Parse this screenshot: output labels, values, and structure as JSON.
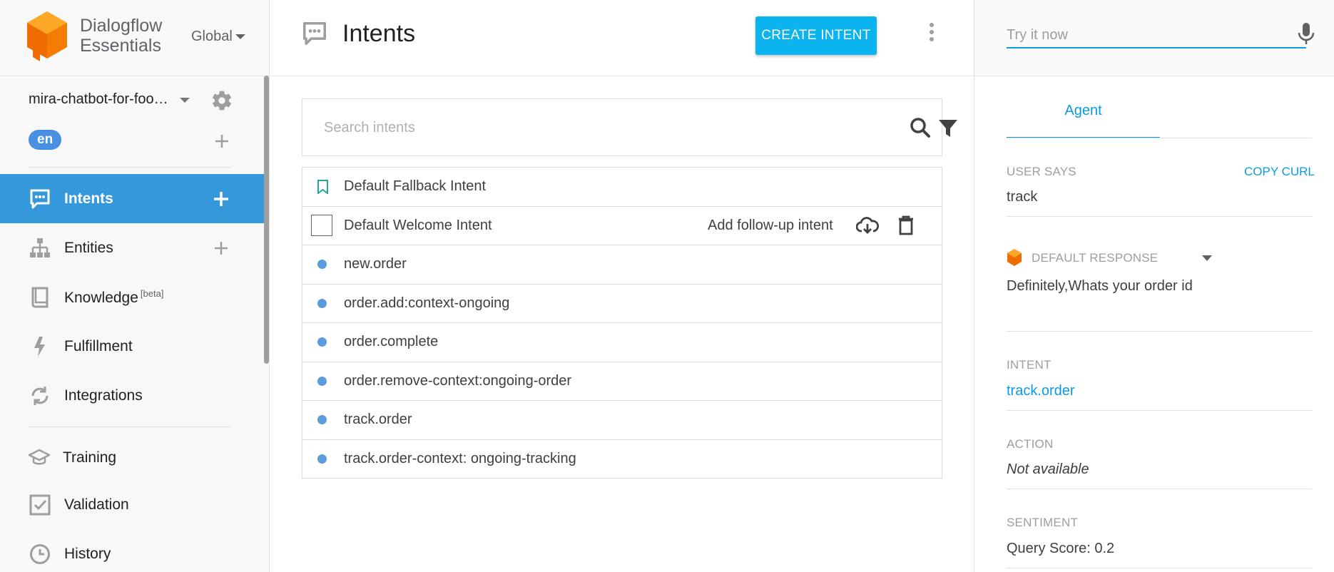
{
  "brand": {
    "line1": "Dialogflow",
    "line2": "Essentials",
    "region": "Global"
  },
  "agent": {
    "name": "mira-chatbot-for-food-delivery",
    "language": "en"
  },
  "nav": {
    "intents": "Intents",
    "entities": "Entities",
    "knowledge": "Knowledge",
    "knowledge_badge": "[beta]",
    "fulfillment": "Fulfillment",
    "integrations": "Integrations",
    "training": "Training",
    "validation": "Validation",
    "history": "History"
  },
  "main": {
    "title": "Intents",
    "create_button": "CREATE INTENT",
    "search_placeholder": "Search intents",
    "follow_up_label": "Add follow-up intent",
    "intents": [
      "Default Fallback Intent",
      "Default Welcome Intent",
      "new.order",
      "order.add:context-ongoing",
      "order.complete",
      "order.remove-context:ongoing-order",
      "track.order",
      "track.order-context: ongoing-tracking"
    ]
  },
  "try_panel": {
    "placeholder": "Try it now",
    "tab": "Agent",
    "user_says_label": "USER SAYS",
    "copy_curl": "COPY CURL",
    "user_says_value": "track",
    "default_response_label": "DEFAULT RESPONSE",
    "default_response_value": "Definitely,Whats your order id",
    "intent_label": "INTENT",
    "intent_value": "track.order",
    "action_label": "ACTION",
    "action_value": "Not available",
    "sentiment_label": "SENTIMENT",
    "sentiment_value": "Query Score: 0.2"
  },
  "colors": {
    "accent": "#0bb4ee",
    "active_nav": "#3498db",
    "link": "#0b9be3",
    "logo": "#f57c00"
  }
}
